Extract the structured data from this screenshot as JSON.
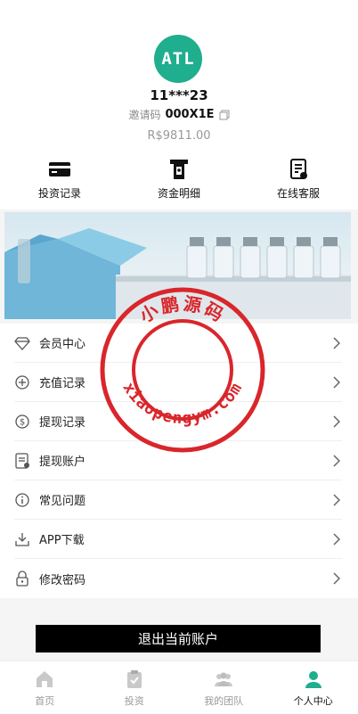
{
  "profile": {
    "avatar_text": "ATL",
    "username": "11***23",
    "invite_label": "邀请码",
    "invite_code": "000X1E",
    "balance": "R$9811.00"
  },
  "shortcuts": [
    {
      "label": "投资记录",
      "icon": "card-icon"
    },
    {
      "label": "资金明细",
      "icon": "atm-icon"
    },
    {
      "label": "在线客服",
      "icon": "document-icon"
    }
  ],
  "menu": [
    {
      "label": "会员中心",
      "icon": "diamond-icon"
    },
    {
      "label": "充值记录",
      "icon": "recharge-icon"
    },
    {
      "label": "提现记录",
      "icon": "dollar-circle-icon"
    },
    {
      "label": "提现账户",
      "icon": "account-doc-icon"
    },
    {
      "label": "常见问题",
      "icon": "info-icon"
    },
    {
      "label": "APP下载",
      "icon": "download-icon"
    },
    {
      "label": "修改密码",
      "icon": "lock-icon"
    }
  ],
  "logout_label": "退出当前账户",
  "tabbar": [
    {
      "label": "首页",
      "icon": "home-icon"
    },
    {
      "label": "投资",
      "icon": "clipboard-icon"
    },
    {
      "label": "我的团队",
      "icon": "team-icon"
    },
    {
      "label": "个人中心",
      "icon": "person-icon",
      "active": true
    }
  ],
  "watermark": {
    "top_text": "小鹏源码",
    "bottom_text": "xiaopengym.com",
    "color": "#d9262b"
  },
  "colors": {
    "accent": "#1fae8e"
  }
}
